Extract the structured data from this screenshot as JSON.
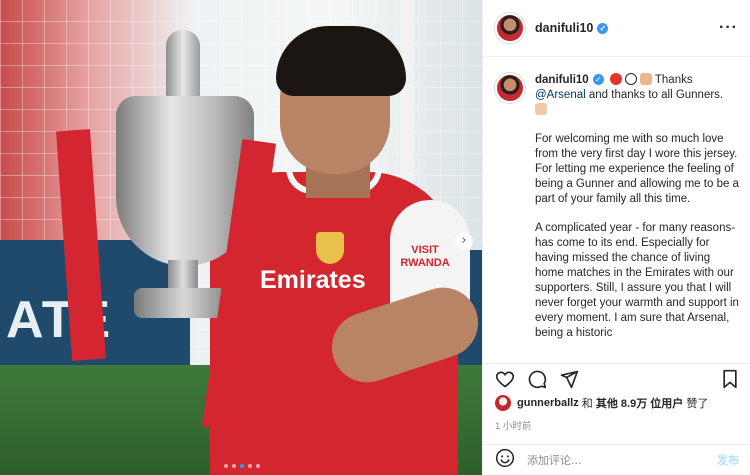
{
  "post": {
    "username": "danifuli10",
    "verified_badge": "✓",
    "more_icon": "···",
    "photo_text": {
      "sponsor": "Emirates",
      "sponsor_line2": "VISIT RWANDA",
      "board_left": "ATE",
      "next_icon": "›"
    },
    "carousel": {
      "count": 5,
      "active_index": 2
    }
  },
  "caption": {
    "username": "danifuli10",
    "verified_badge": "✓",
    "line1_suffix": "Thanks",
    "mention": "@Arsenal",
    "line2": " and thanks to all Gunners.",
    "para1": "For welcoming me with so much love from the very first day I wore this jersey. For letting me experience the feeling of being a Gunner and allowing me to be a part of your family all this time.",
    "para2": "A complicated year - for many reasons- has come to its end. Especially for having missed the chance of living home matches in the Emirates with our supporters. Still, I assure you that I will never forget your warmth and support in every moment. I am sure that Arsenal, being a historic"
  },
  "actions": {
    "like_icon": "heart-icon",
    "comment_icon": "comment-icon",
    "share_icon": "share-icon",
    "save_icon": "bookmark-icon"
  },
  "likes": {
    "user": "gunnerballz",
    "connector": " 和 ",
    "others_label": "其他 ",
    "count": "8.9万",
    "suffix": " 位用户",
    "verb": " 赞了"
  },
  "timestamp": "1 小时前",
  "comment": {
    "placeholder": "添加评论...",
    "post_label": "发布",
    "emoji_icon": "smiley-icon"
  },
  "colors": {
    "link": "#00376b",
    "verified": "#3897f0",
    "post_disabled": "#b2dffc",
    "secondary_text": "#8e8e8e"
  }
}
